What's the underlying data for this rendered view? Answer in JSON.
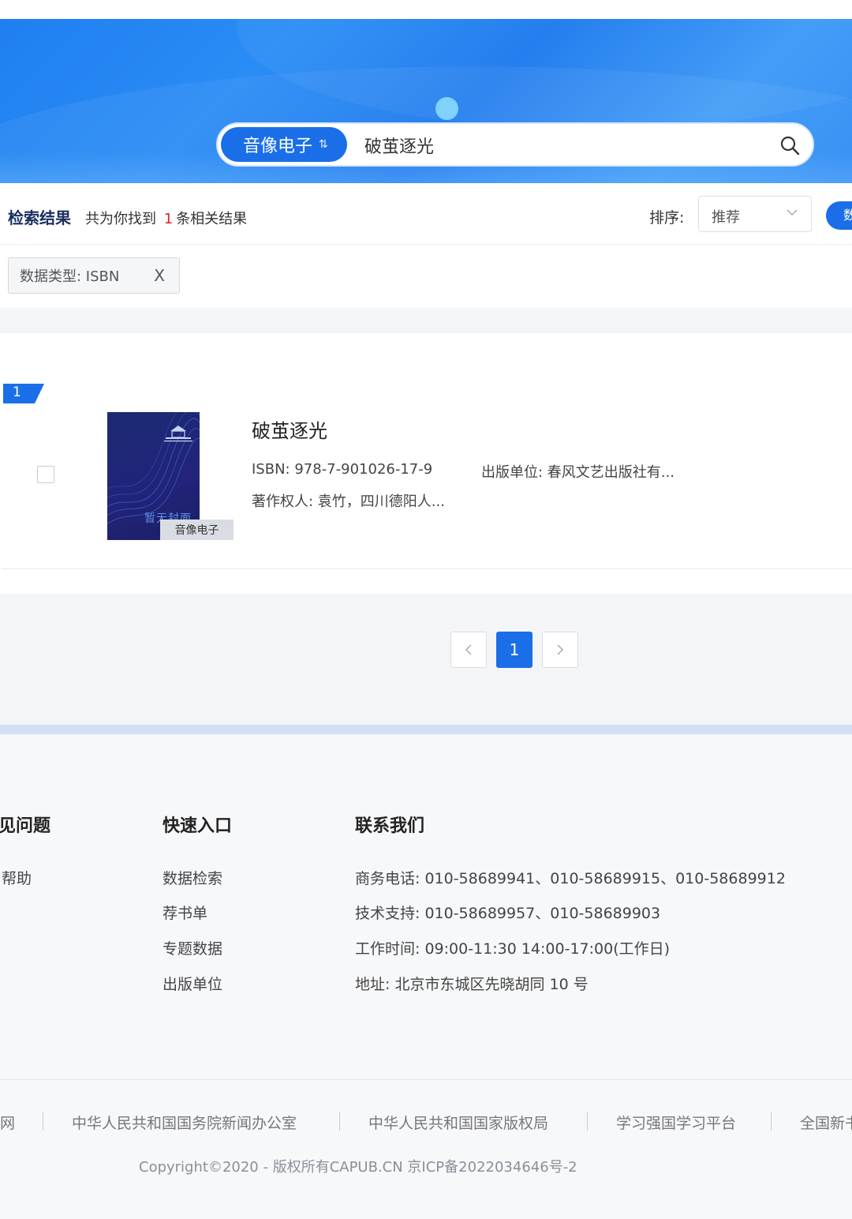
{
  "search": {
    "type_label": "音像电子",
    "swap_glyph": "⇅",
    "query": "破茧逐光"
  },
  "results": {
    "title": "检索结果",
    "found_prefix": "共为你找到",
    "count": "1",
    "found_suffix": "条相关结果",
    "sort_label": "排序:",
    "sort_value": "推荐",
    "edge_button": "数"
  },
  "filters": [
    {
      "label": "数据类型:  ISBN",
      "close": "X"
    }
  ],
  "items": [
    {
      "rank": "1",
      "title": "破茧逐光",
      "isbn": "ISBN:  978-7-901026-17-9",
      "publisher": "出版单位:  春风文艺出版社有...",
      "author": "著作权人:  袁竹，四川德阳人...",
      "cover_text": "暂无封面",
      "type_tag": "音像电子"
    }
  ],
  "pagination": {
    "prev": "<",
    "current": "1",
    "next": ">"
  },
  "footer": {
    "col1": {
      "title": "见问题",
      "items": [
        "帮助"
      ]
    },
    "col2": {
      "title": "快速入口",
      "items": [
        "数据检索",
        "荐书单",
        "专题数据",
        "出版单位"
      ]
    },
    "col3": {
      "title": "联系我们",
      "items": [
        "商务电话: 010-58689941、010-58689915、010-58689912",
        "技术支持: 010-58689957、010-58689903",
        "工作时间: 09:00-11:30 14:00-17:00(工作日)",
        "地址: 北京市东城区先晓胡同 10 号"
      ]
    },
    "links": [
      "网",
      "中华人民共和国国务院新闻办公室",
      "中华人民共和国国家版权局",
      "学习强国学习平台",
      "全国新书"
    ],
    "copyright": "Copyright©2020 - 版权所有CAPUB.CN 京ICP备2022034646号-2"
  },
  "colors": {
    "primary": "#1a6fe8",
    "count_red": "#e02020",
    "banner": "#2a8cf5"
  }
}
